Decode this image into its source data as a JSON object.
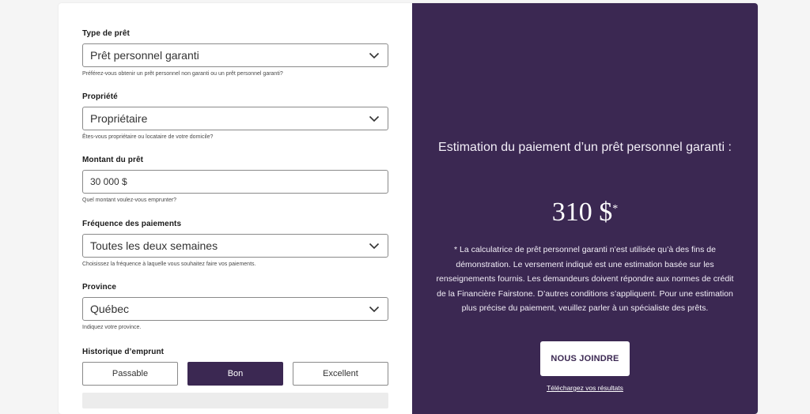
{
  "form": {
    "loan_type": {
      "label": "Type de prêt",
      "value": "Prêt personnel garanti",
      "help": "Préférez-vous obtenir un prêt personnel non garanti ou un prêt personnel garanti?"
    },
    "ownership": {
      "label": "Propriété",
      "value": "Propriétaire",
      "help": "Êtes-vous propriétaire ou locataire de votre domicile?"
    },
    "amount": {
      "label": "Montant du prêt",
      "value": "30 000 $",
      "help": "Quel montant voulez-vous emprunter?"
    },
    "frequency": {
      "label": "Fréquence des paiements",
      "value": "Toutes les deux semaines",
      "help": "Choisissez la fréquence à laquelle vous souhaitez faire vos paiements."
    },
    "province": {
      "label": "Province",
      "value": "Québec",
      "help": "Indiquez votre province."
    },
    "credit_history": {
      "label": "Historique d’emprunt",
      "options": [
        "Passable",
        "Bon",
        "Excellent"
      ],
      "selected": "Bon"
    }
  },
  "result": {
    "title": "Estimation du paiement d’un prêt personnel garanti :",
    "amount": "310 $",
    "amount_marker": "*",
    "disclaimer": "* La calculatrice de prêt personnel garanti n’est utilisée qu’à des fins de démonstration. Le versement indiqué est une estimation basée sur les renseignements fournis. Les demandeurs doivent répondre aux normes de crédit de la Financière Fairstone. D’autres conditions s’appliquent. Pour une estimation plus précise du paiement, veuillez parler à un spécialiste des prêts.",
    "cta_label": "NOUS JOINDRE",
    "download_label": "Téléchargez vos résultats"
  },
  "icons": {
    "dropdown": "chevron-down-icon"
  },
  "colors": {
    "accent": "#3b2852",
    "background": "#f5f5f5"
  }
}
